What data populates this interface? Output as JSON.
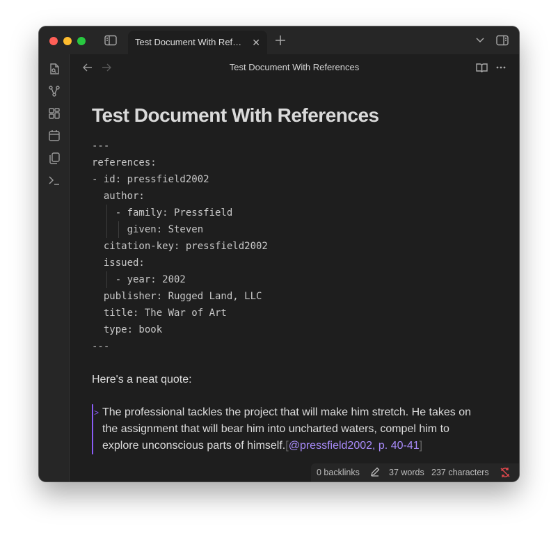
{
  "tab": {
    "title": "Test Document With References"
  },
  "navbar": {
    "title": "Test Document With References"
  },
  "document": {
    "title": "Test Document With References",
    "frontmatter": [
      {
        "indent": 0,
        "text": "---"
      },
      {
        "indent": 0,
        "text": "references:"
      },
      {
        "indent": 0,
        "text": "- id: pressfield2002"
      },
      {
        "indent": 2,
        "text": "author:"
      },
      {
        "indent": 4,
        "text": "- family: Pressfield"
      },
      {
        "indent": 6,
        "text": "given: Steven"
      },
      {
        "indent": 2,
        "text": "citation-key: pressfield2002"
      },
      {
        "indent": 2,
        "text": "issued:"
      },
      {
        "indent": 4,
        "text": "- year: 2002"
      },
      {
        "indent": 2,
        "text": "publisher: Rugged Land, LLC"
      },
      {
        "indent": 2,
        "text": "title: The War of Art"
      },
      {
        "indent": 2,
        "text": "type: book"
      },
      {
        "indent": 0,
        "text": "---"
      }
    ],
    "intro": "Here's a neat quote:",
    "quote": {
      "lines": [
        "The professional tackles the project that will make him stretch. He takes on",
        "the assignment that will bear him into uncharted waters, compel him to",
        "explore unconscious parts of himself."
      ],
      "open_bracket": "[",
      "citation": "@pressfield2002, p. 40-41",
      "close_bracket": "]"
    }
  },
  "status": {
    "backlinks": "0 backlinks",
    "words": "37 words",
    "characters": "237 characters"
  },
  "colors": {
    "accent": "#8a5cf5",
    "sync_error": "#e5484d"
  },
  "icons": {
    "ribbon": [
      "open-quick-switcher-icon",
      "graph-view-icon",
      "canvas-icon",
      "daily-note-icon",
      "templates-icon",
      "command-palette-icon"
    ]
  }
}
